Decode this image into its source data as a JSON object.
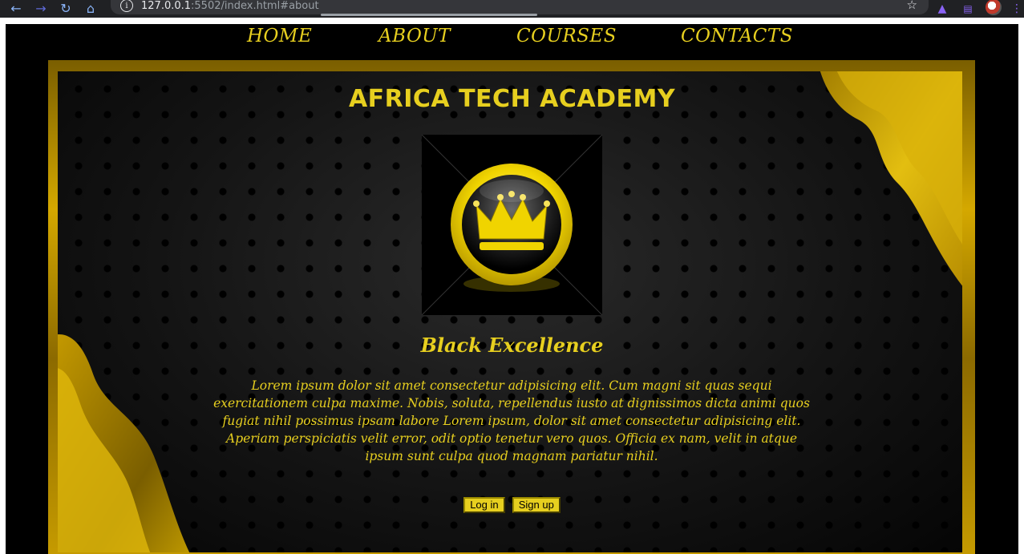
{
  "browser": {
    "url_host": "127.0.0.1",
    "url_rest": ":5502/index.html#about",
    "info_glyph": "i"
  },
  "nav": {
    "items": [
      {
        "label": "HOME"
      },
      {
        "label": "ABOUT"
      },
      {
        "label": "COURSES"
      },
      {
        "label": "CONTACTS"
      }
    ]
  },
  "hero": {
    "title": "AFRICA TECH ACADEMY",
    "subtitle": "Black Excellence",
    "body": "Lorem ipsum dolor sit amet consectetur adipisicing elit. Cum magni sit quas sequi exercitationem culpa maxime. Nobis, soluta, repellendus iusto at dignissimos dicta animi quos fugiat nihil possimus ipsam labore Lorem ipsum, dolor sit amet consectetur adipisicing elit. Aperiam perspiciatis velit error, odit optio tenetur vero quos. Officia ex nam, velit in atque ipsum sunt culpa quod magnam pariatur nihil.",
    "login_label": "Log in",
    "signup_label": "Sign up"
  },
  "colors": {
    "accent": "#e7cf1f",
    "background": "#000000",
    "frame_gold": "#d4a800"
  },
  "icons": {
    "back": "arrow-left-icon",
    "forward": "arrow-right-icon",
    "reload": "reload-icon",
    "home": "home-icon",
    "bookmark": "star-icon",
    "extensions": "puzzle-icon",
    "cast": "cast-icon",
    "profile": "avatar",
    "menu": "kebab-menu-icon",
    "logo": "crown-icon"
  }
}
